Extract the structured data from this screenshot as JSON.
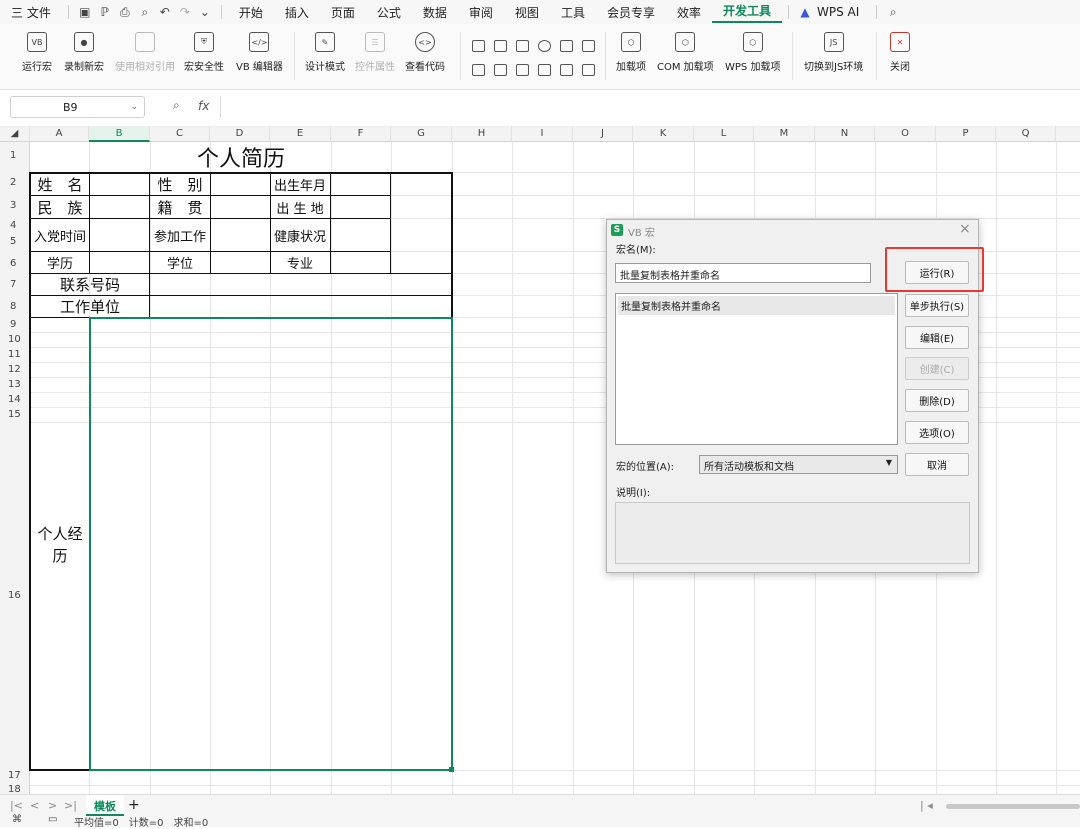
{
  "menubar": {
    "file": "三 文件",
    "tabs": [
      "开始",
      "插入",
      "页面",
      "公式",
      "数据",
      "审阅",
      "视图",
      "工具",
      "会员专享",
      "效率",
      "开发工具",
      "WPS AI"
    ]
  },
  "ribbon": {
    "buttons": [
      "运行宏",
      "录制新宏",
      "使用相对引用",
      "宏安全性",
      "VB 编辑器",
      "设计模式",
      "控件属性",
      "查看代码",
      "加载项",
      "COM 加载项",
      "WPS 加载项",
      "切换到JS环境",
      "关闭"
    ]
  },
  "formula": {
    "name_box": "B9",
    "fx": "fx"
  },
  "grid": {
    "columns": [
      "A",
      "B",
      "C",
      "D",
      "E",
      "F",
      "G",
      "H",
      "I",
      "J",
      "K",
      "L",
      "M",
      "N",
      "O",
      "P",
      "Q"
    ],
    "rows": [
      "1",
      "2",
      "3",
      "4",
      "5",
      "6",
      "7",
      "8",
      "9",
      "10",
      "11",
      "12",
      "13",
      "14",
      "15",
      "16",
      "17",
      "18"
    ],
    "title": "个人简历",
    "cells": {
      "name": "姓　名",
      "gender": "性　别",
      "birth": "出生年月",
      "ethnic": "民　族",
      "native": "籍　贯",
      "birthplace": "出 生 地",
      "party": "入党时间",
      "work_start": "参加工作",
      "health": "健康状况",
      "edu": "学历",
      "degree": "学位",
      "major": "专业",
      "phone": "联系号码",
      "employer": "工作单位",
      "experience_line1": "个人经",
      "experience_line2": "历"
    }
  },
  "sheets": {
    "current": "模板",
    "add": "+"
  },
  "status": {
    "text": "平均值=0　计数=0　求和=0"
  },
  "dialog": {
    "title": "VB 宏",
    "macro_name_label": "宏名(M):",
    "macro_name_value": "批量复制表格并重命名",
    "macro_list": [
      "批量复制表格并重命名"
    ],
    "run": "运行(R)",
    "step": "单步执行(S)",
    "edit": "编辑(E)",
    "create": "创建(C)",
    "delete": "删除(D)",
    "options": "选项(O)",
    "location_label": "宏的位置(A):",
    "location_value": "所有活动模板和文档",
    "cancel": "取消",
    "desc_label": "说明(I):"
  },
  "colors": {
    "accent": "#0e8a5a",
    "highlight": "#e53935"
  }
}
